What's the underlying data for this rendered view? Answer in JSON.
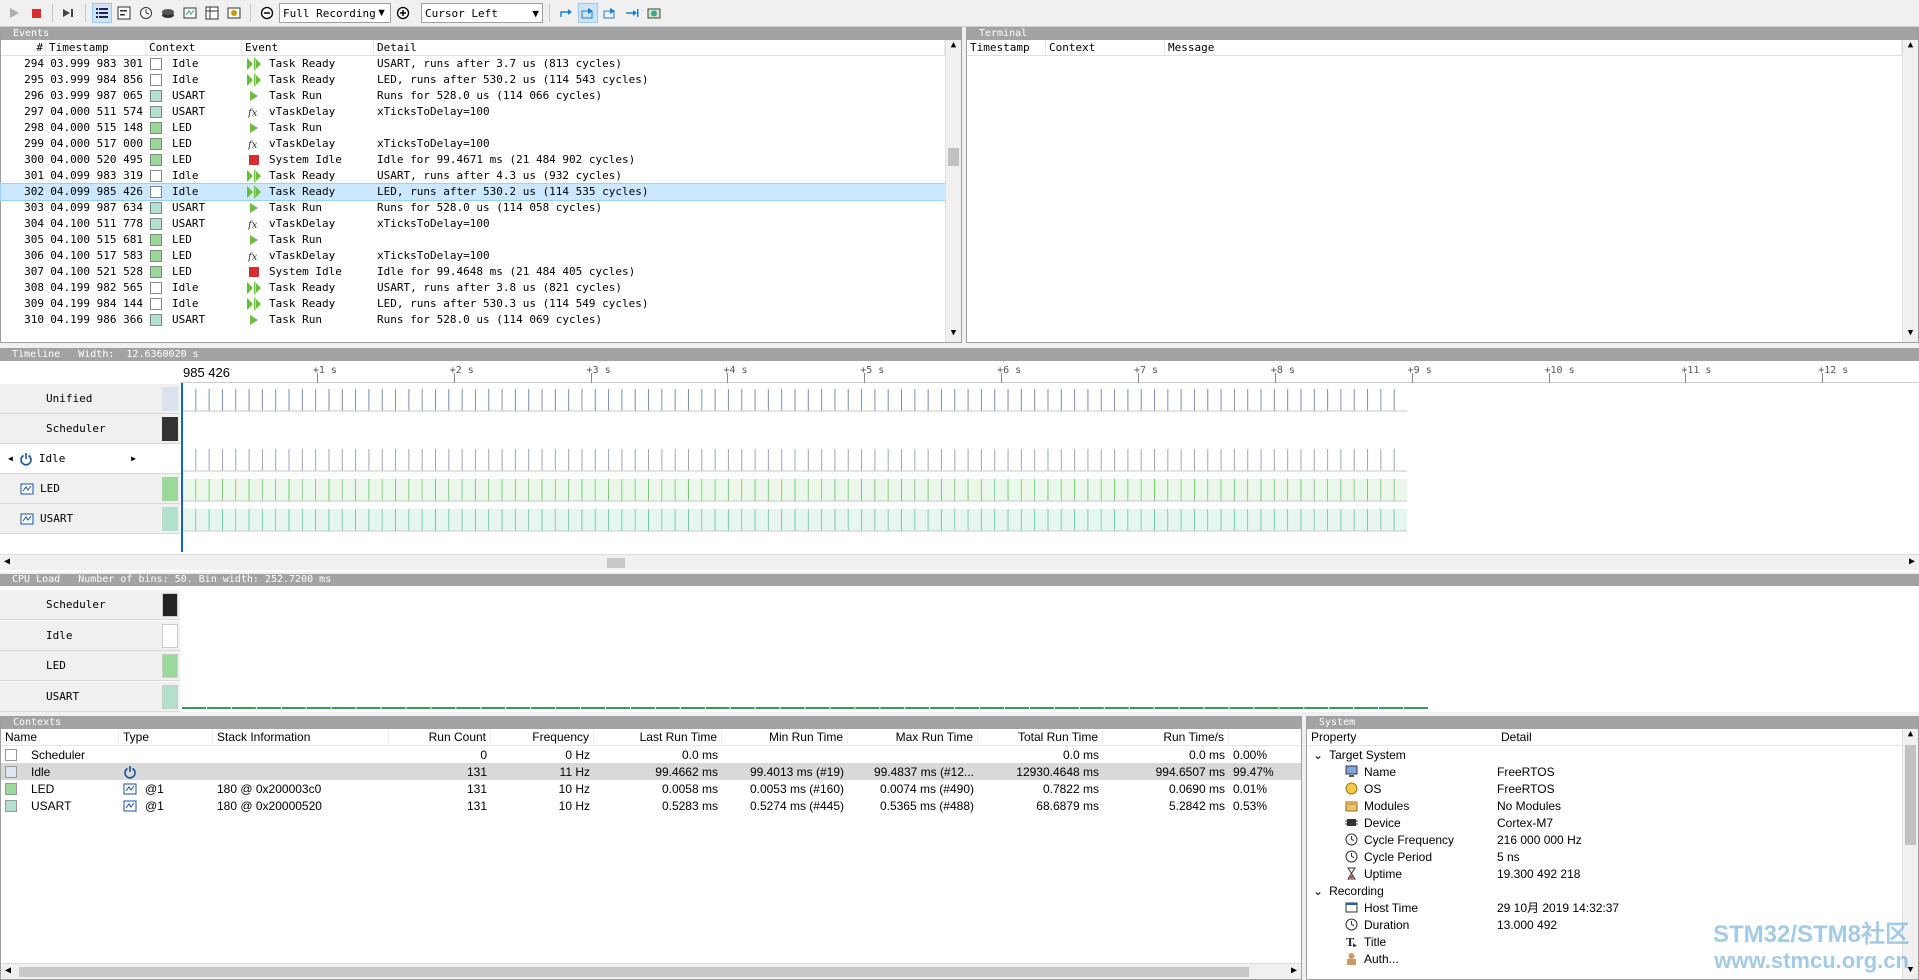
{
  "toolbar": {
    "recording_mode": "Full Recording",
    "cursor_mode": "Cursor Left"
  },
  "events": {
    "title": "Events",
    "columns": [
      "#",
      "Timestamp",
      "Context",
      "Event",
      "Detail"
    ],
    "rows": [
      {
        "num": "294",
        "ts": "03.999 983 301",
        "ctx": "Idle",
        "ctx_color": "#ffffff",
        "event": "Task Ready",
        "event_icon": "task-ready-icon",
        "detail": "USART, runs after 3.7 us (813 cycles)"
      },
      {
        "num": "295",
        "ts": "03.999 984 856",
        "ctx": "Idle",
        "ctx_color": "#ffffff",
        "event": "Task Ready",
        "event_icon": "task-ready-icon",
        "detail": "LED, runs after 530.2 us (114 543 cycles)"
      },
      {
        "num": "296",
        "ts": "03.999 987 065",
        "ctx": "USART",
        "ctx_color": "#b3e0cc",
        "event": "Task Run",
        "event_icon": "task-run-icon",
        "detail": "Runs for 528.0 us (114 066 cycles)"
      },
      {
        "num": "297",
        "ts": "04.000 511 574",
        "ctx": "USART",
        "ctx_color": "#b3e0cc",
        "event": "vTaskDelay",
        "event_icon": "function-icon",
        "detail": "xTicksToDelay=100"
      },
      {
        "num": "298",
        "ts": "04.000 515 148",
        "ctx": "LED",
        "ctx_color": "#9ad99a",
        "event": "Task Run",
        "event_icon": "task-run-icon",
        "detail": ""
      },
      {
        "num": "299",
        "ts": "04.000 517 000",
        "ctx": "LED",
        "ctx_color": "#9ad99a",
        "event": "vTaskDelay",
        "event_icon": "function-icon",
        "detail": "xTicksToDelay=100"
      },
      {
        "num": "300",
        "ts": "04.000 520 495",
        "ctx": "LED",
        "ctx_color": "#9ad99a",
        "event": "System Idle",
        "event_icon": "system-idle-icon",
        "detail": "Idle for 99.4671 ms (21 484 902 cycles)"
      },
      {
        "num": "301",
        "ts": "04.099 983 319",
        "ctx": "Idle",
        "ctx_color": "#ffffff",
        "event": "Task Ready",
        "event_icon": "task-ready-icon",
        "detail": "USART, runs after 4.3 us (932 cycles)"
      },
      {
        "num": "302",
        "ts": "04.099 985 426",
        "ctx": "Idle",
        "ctx_color": "#ffffff",
        "event": "Task Ready",
        "event_icon": "task-ready-icon",
        "detail": "LED, runs after 530.2 us (114 535 cycles)",
        "selected": true
      },
      {
        "num": "303",
        "ts": "04.099 987 634",
        "ctx": "USART",
        "ctx_color": "#b3e0cc",
        "event": "Task Run",
        "event_icon": "task-run-icon",
        "detail": "Runs for 528.0 us (114 058 cycles)"
      },
      {
        "num": "304",
        "ts": "04.100 511 778",
        "ctx": "USART",
        "ctx_color": "#b3e0cc",
        "event": "vTaskDelay",
        "event_icon": "function-icon",
        "detail": "xTicksToDelay=100"
      },
      {
        "num": "305",
        "ts": "04.100 515 681",
        "ctx": "LED",
        "ctx_color": "#9ad99a",
        "event": "Task Run",
        "event_icon": "task-run-icon",
        "detail": ""
      },
      {
        "num": "306",
        "ts": "04.100 517 583",
        "ctx": "LED",
        "ctx_color": "#9ad99a",
        "event": "vTaskDelay",
        "event_icon": "function-icon",
        "detail": "xTicksToDelay=100"
      },
      {
        "num": "307",
        "ts": "04.100 521 528",
        "ctx": "LED",
        "ctx_color": "#9ad99a",
        "event": "System Idle",
        "event_icon": "system-idle-icon",
        "detail": "Idle for 99.4648 ms (21 484 405 cycles)"
      },
      {
        "num": "308",
        "ts": "04.199 982 565",
        "ctx": "Idle",
        "ctx_color": "#ffffff",
        "event": "Task Ready",
        "event_icon": "task-ready-icon",
        "detail": "USART, runs after 3.8 us (821 cycles)"
      },
      {
        "num": "309",
        "ts": "04.199 984 144",
        "ctx": "Idle",
        "ctx_color": "#ffffff",
        "event": "Task Ready",
        "event_icon": "task-ready-icon",
        "detail": "LED, runs after 530.3 us (114 549 cycles)"
      },
      {
        "num": "310",
        "ts": "04.199 986 366",
        "ctx": "USART",
        "ctx_color": "#b3e0cc",
        "event": "Task Run",
        "event_icon": "task-run-icon",
        "detail": "Runs for 528.0 us (114 069 cycles)"
      }
    ]
  },
  "terminal": {
    "title": "Terminal",
    "columns": [
      "Timestamp",
      "Context",
      "Message"
    ]
  },
  "timeline": {
    "title": "Timeline",
    "width_label": "Width:",
    "width_value": "12.6360020 s",
    "cursor_label": "985 426",
    "ticks": [
      "+1 s",
      "+2 s",
      "+3 s",
      "+4 s",
      "+5 s",
      "+6 s",
      "+7 s",
      "+8 s",
      "+9 s",
      "+10 s",
      "+11 s",
      "+12 s"
    ],
    "rows": [
      {
        "label": "Unified",
        "color": "#dde3ee"
      },
      {
        "label": "Scheduler",
        "color": "#333333"
      },
      {
        "label": "Idle",
        "color": "#ffffff",
        "icon": "power-icon"
      },
      {
        "label": "LED",
        "color": "#9ad99a",
        "icon": "task-icon"
      },
      {
        "label": "USART",
        "color": "#b3e0cc",
        "icon": "task-icon"
      }
    ]
  },
  "cpuload": {
    "title": "CPU Load",
    "bins_label": "Number of bins:",
    "bins": "50.",
    "binwidth_label": "Bin width:",
    "binwidth": "252.7200 ms",
    "rows": [
      {
        "label": "Scheduler",
        "color": "#222222"
      },
      {
        "label": "Idle",
        "color": "#ffffff"
      },
      {
        "label": "LED",
        "color": "#9ad99a"
      },
      {
        "label": "USART",
        "color": "#b3e0cc"
      }
    ]
  },
  "contexts": {
    "title": "Contexts",
    "columns": [
      "Name",
      "Type",
      "Stack Information",
      "Run Count",
      "Frequency",
      "Last Run Time",
      "Min Run Time",
      "Max Run Time",
      "Total Run Time",
      "Run Time/s",
      ""
    ],
    "rows": [
      {
        "name": "Scheduler",
        "color": "#ffffff",
        "type_icon": "",
        "type": "",
        "stack": "",
        "run_count": "0",
        "freq": "0 Hz",
        "last": "0.0 ms",
        "min": "",
        "max": "",
        "total": "0.0 ms",
        "per_s": "0.0 ms",
        "pct": "0.00%"
      },
      {
        "name": "Idle",
        "color": "#dce6f4",
        "type_icon": "power-icon",
        "type": "",
        "stack": "",
        "run_count": "131",
        "freq": "11 Hz",
        "last": "99.4662 ms",
        "min": "99.4013 ms (#19)",
        "max": "99.4837 ms (#12...",
        "total": "12930.4648 ms",
        "per_s": "994.6507 ms",
        "pct": "99.47%",
        "selected": true
      },
      {
        "name": "LED",
        "color": "#9ad99a",
        "type_icon": "task-icon",
        "type": "@1",
        "stack": "180 @ 0x200003c0",
        "run_count": "131",
        "freq": "10 Hz",
        "last": "0.0058 ms",
        "min": "0.0053 ms (#160)",
        "max": "0.0074 ms (#490)",
        "total": "0.7822 ms",
        "per_s": "0.0690 ms",
        "pct": "0.01%"
      },
      {
        "name": "USART",
        "color": "#b3e0cc",
        "type_icon": "task-icon",
        "type": "@1",
        "stack": "180 @ 0x20000520",
        "run_count": "131",
        "freq": "10 Hz",
        "last": "0.5283 ms",
        "min": "0.5274 ms (#445)",
        "max": "0.5365 ms (#488)",
        "total": "68.6879 ms",
        "per_s": "5.2842 ms",
        "pct": "0.53%"
      }
    ]
  },
  "system": {
    "title": "System",
    "columns": [
      "Property",
      "Detail"
    ],
    "groups": [
      {
        "label": "Target System",
        "items": [
          {
            "icon": "computer-icon",
            "prop": "Name",
            "detail": "FreeRTOS"
          },
          {
            "icon": "os-icon",
            "prop": "OS",
            "detail": "FreeRTOS"
          },
          {
            "icon": "modules-icon",
            "prop": "Modules",
            "detail": "No Modules"
          },
          {
            "icon": "chip-icon",
            "prop": "Device",
            "detail": "Cortex-M7"
          },
          {
            "icon": "clock-icon",
            "prop": "Cycle Frequency",
            "detail": "216 000 000 Hz"
          },
          {
            "icon": "clock-icon",
            "prop": "Cycle Period",
            "detail": "5 ns"
          },
          {
            "icon": "hourglass-icon",
            "prop": "Uptime",
            "detail": "19.300 492 218"
          }
        ]
      },
      {
        "label": "Recording",
        "items": [
          {
            "icon": "host-icon",
            "prop": "Host Time",
            "detail": "29 10月 2019 14:32:37"
          },
          {
            "icon": "clock-icon",
            "prop": "Duration",
            "detail": "13.000 492"
          },
          {
            "icon": "title-icon",
            "prop": "Title",
            "detail": ""
          },
          {
            "icon": "author-icon",
            "prop": "Auth...",
            "detail": ""
          }
        ]
      }
    ]
  },
  "watermark": {
    "line1": "STM32/STM8社区",
    "line2": "www.stmcu.org.cn"
  }
}
